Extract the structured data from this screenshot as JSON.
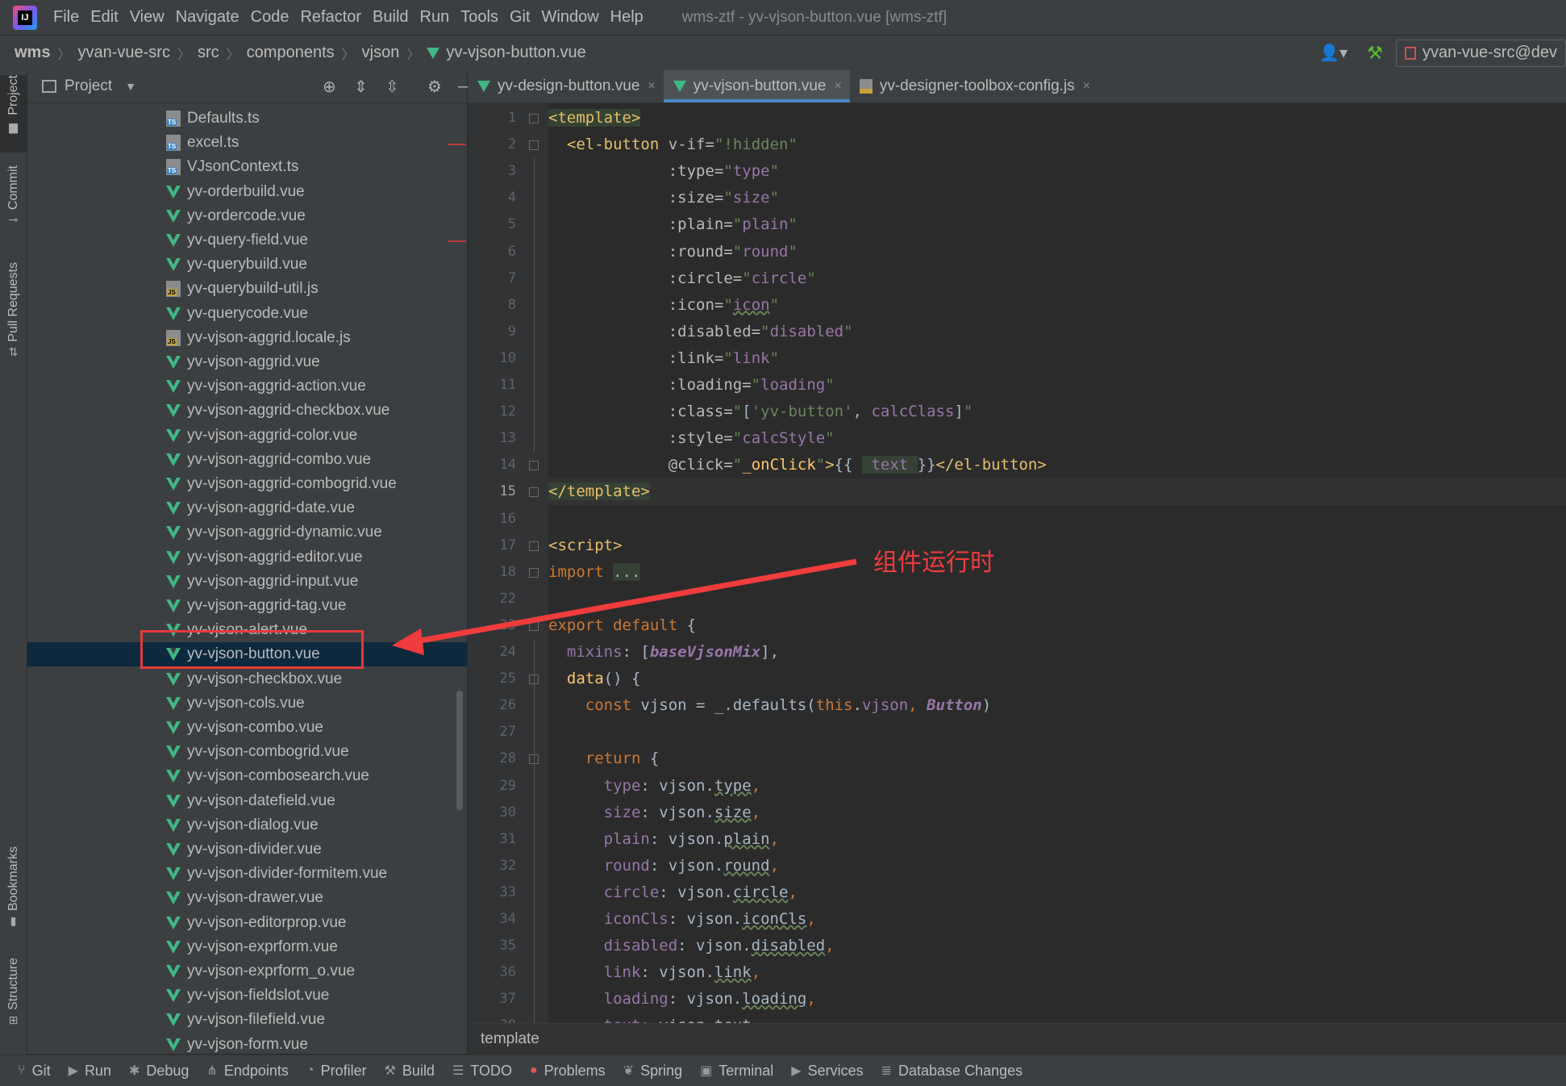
{
  "menubar": {
    "items": [
      "File",
      "Edit",
      "View",
      "Navigate",
      "Code",
      "Refactor",
      "Build",
      "Run",
      "Tools",
      "Git",
      "Window",
      "Help"
    ],
    "title": "wms-ztf - yv-vjson-button.vue [wms-ztf]"
  },
  "breadcrumb": {
    "items": [
      "wms",
      "yvan-vue-src",
      "src",
      "components",
      "vjson",
      "yv-vjson-button.vue"
    ],
    "branch": "yvan-vue-src@dev"
  },
  "left_stripe": {
    "project": "Project",
    "commit": "Commit",
    "pull_requests": "Pull Requests",
    "bookmarks": "Bookmarks",
    "structure": "Structure"
  },
  "project_panel": {
    "title": "Project"
  },
  "tree": [
    {
      "label": "Defaults.ts",
      "icon": "ts"
    },
    {
      "label": "excel.ts",
      "icon": "ts"
    },
    {
      "label": "VJsonContext.ts",
      "icon": "ts"
    },
    {
      "label": "yv-orderbuild.vue",
      "icon": "vue"
    },
    {
      "label": "yv-ordercode.vue",
      "icon": "vue"
    },
    {
      "label": "yv-query-field.vue",
      "icon": "vue"
    },
    {
      "label": "yv-querybuild.vue",
      "icon": "vue"
    },
    {
      "label": "yv-querybuild-util.js",
      "icon": "js"
    },
    {
      "label": "yv-querycode.vue",
      "icon": "vue"
    },
    {
      "label": "yv-vjson-aggrid.locale.js",
      "icon": "js"
    },
    {
      "label": "yv-vjson-aggrid.vue",
      "icon": "vue"
    },
    {
      "label": "yv-vjson-aggrid-action.vue",
      "icon": "vue"
    },
    {
      "label": "yv-vjson-aggrid-checkbox.vue",
      "icon": "vue"
    },
    {
      "label": "yv-vjson-aggrid-color.vue",
      "icon": "vue"
    },
    {
      "label": "yv-vjson-aggrid-combo.vue",
      "icon": "vue"
    },
    {
      "label": "yv-vjson-aggrid-combogrid.vue",
      "icon": "vue"
    },
    {
      "label": "yv-vjson-aggrid-date.vue",
      "icon": "vue"
    },
    {
      "label": "yv-vjson-aggrid-dynamic.vue",
      "icon": "vue"
    },
    {
      "label": "yv-vjson-aggrid-editor.vue",
      "icon": "vue"
    },
    {
      "label": "yv-vjson-aggrid-input.vue",
      "icon": "vue"
    },
    {
      "label": "yv-vjson-aggrid-tag.vue",
      "icon": "vue"
    },
    {
      "label": "yv-vjson-alert.vue",
      "icon": "vue"
    },
    {
      "label": "yv-vjson-button.vue",
      "icon": "vue",
      "selected": true
    },
    {
      "label": "yv-vjson-checkbox.vue",
      "icon": "vue"
    },
    {
      "label": "yv-vjson-cols.vue",
      "icon": "vue"
    },
    {
      "label": "yv-vjson-combo.vue",
      "icon": "vue"
    },
    {
      "label": "yv-vjson-combogrid.vue",
      "icon": "vue"
    },
    {
      "label": "yv-vjson-combosearch.vue",
      "icon": "vue"
    },
    {
      "label": "yv-vjson-datefield.vue",
      "icon": "vue"
    },
    {
      "label": "yv-vjson-dialog.vue",
      "icon": "vue"
    },
    {
      "label": "yv-vjson-divider.vue",
      "icon": "vue"
    },
    {
      "label": "yv-vjson-divider-formitem.vue",
      "icon": "vue"
    },
    {
      "label": "yv-vjson-drawer.vue",
      "icon": "vue"
    },
    {
      "label": "yv-vjson-editorprop.vue",
      "icon": "vue"
    },
    {
      "label": "yv-vjson-exprform.vue",
      "icon": "vue"
    },
    {
      "label": "yv-vjson-exprform_o.vue",
      "icon": "vue"
    },
    {
      "label": "yv-vjson-fieldslot.vue",
      "icon": "vue"
    },
    {
      "label": "yv-vjson-filefield.vue",
      "icon": "vue"
    },
    {
      "label": "yv-vjson-form.vue",
      "icon": "vue"
    }
  ],
  "editor_tabs": [
    {
      "label": "yv-design-button.vue",
      "icon": "vue",
      "active": false
    },
    {
      "label": "yv-vjson-button.vue",
      "icon": "vue",
      "active": true
    },
    {
      "label": "yv-designer-toolbox-config.js",
      "icon": "js",
      "active": false
    }
  ],
  "code": {
    "current_line": "15",
    "lines": [
      {
        "n": "1",
        "parts": [
          [
            "tag hl",
            "<template>"
          ]
        ]
      },
      {
        "n": "2",
        "parts": [
          [
            "plain",
            "  "
          ],
          [
            "tag",
            "<el-button "
          ],
          [
            "attr",
            "v-if="
          ],
          [
            "str",
            "\"!hidden\""
          ]
        ]
      },
      {
        "n": "3",
        "parts": [
          [
            "plain",
            "             "
          ],
          [
            "attr",
            ":type="
          ],
          [
            "str",
            "\""
          ],
          [
            "prop",
            "type"
          ],
          [
            "str",
            "\""
          ]
        ]
      },
      {
        "n": "4",
        "parts": [
          [
            "plain",
            "             "
          ],
          [
            "attr",
            ":size="
          ],
          [
            "str",
            "\""
          ],
          [
            "prop",
            "size"
          ],
          [
            "str",
            "\""
          ]
        ]
      },
      {
        "n": "5",
        "parts": [
          [
            "plain",
            "             "
          ],
          [
            "attr",
            ":plain="
          ],
          [
            "str",
            "\""
          ],
          [
            "prop",
            "plain"
          ],
          [
            "str",
            "\""
          ]
        ]
      },
      {
        "n": "6",
        "parts": [
          [
            "plain",
            "             "
          ],
          [
            "attr",
            ":round="
          ],
          [
            "str",
            "\""
          ],
          [
            "prop",
            "round"
          ],
          [
            "str",
            "\""
          ]
        ]
      },
      {
        "n": "7",
        "parts": [
          [
            "plain",
            "             "
          ],
          [
            "attr",
            ":circle="
          ],
          [
            "str",
            "\""
          ],
          [
            "prop",
            "circle"
          ],
          [
            "str",
            "\""
          ]
        ]
      },
      {
        "n": "8",
        "parts": [
          [
            "plain",
            "             "
          ],
          [
            "attr",
            ":icon="
          ],
          [
            "str",
            "\""
          ],
          [
            "prop sq",
            "icon"
          ],
          [
            "str",
            "\""
          ]
        ]
      },
      {
        "n": "9",
        "parts": [
          [
            "plain",
            "             "
          ],
          [
            "attr",
            ":disabled="
          ],
          [
            "str",
            "\""
          ],
          [
            "prop",
            "disabled"
          ],
          [
            "str",
            "\""
          ]
        ]
      },
      {
        "n": "10",
        "parts": [
          [
            "plain",
            "             "
          ],
          [
            "attr",
            ":link="
          ],
          [
            "str",
            "\""
          ],
          [
            "prop",
            "link"
          ],
          [
            "str",
            "\""
          ]
        ]
      },
      {
        "n": "11",
        "parts": [
          [
            "plain",
            "             "
          ],
          [
            "attr",
            ":loading="
          ],
          [
            "str",
            "\""
          ],
          [
            "prop",
            "loading"
          ],
          [
            "str",
            "\""
          ]
        ]
      },
      {
        "n": "12",
        "parts": [
          [
            "plain",
            "             "
          ],
          [
            "attr",
            ":class="
          ],
          [
            "str",
            "\""
          ],
          [
            "plain",
            "["
          ],
          [
            "str",
            "'yv-button'"
          ],
          [
            "plain",
            ", "
          ],
          [
            "prop",
            "calcClass"
          ],
          [
            "plain",
            "]"
          ],
          [
            "str",
            "\""
          ]
        ]
      },
      {
        "n": "13",
        "parts": [
          [
            "plain",
            "             "
          ],
          [
            "attr",
            ":style="
          ],
          [
            "str",
            "\""
          ],
          [
            "prop",
            "calcStyle"
          ],
          [
            "str",
            "\""
          ]
        ]
      },
      {
        "n": "14",
        "parts": [
          [
            "plain",
            "             "
          ],
          [
            "attr",
            "@click="
          ],
          [
            "str",
            "\""
          ],
          [
            "fn",
            "_onClick"
          ],
          [
            "str",
            "\""
          ],
          [
            "tag",
            ">"
          ],
          [
            "plain",
            "{{ "
          ],
          [
            "prop hl",
            " text "
          ],
          [
            "plain",
            "}}"
          ],
          [
            "tag",
            "</el-button>"
          ]
        ]
      },
      {
        "n": "15",
        "parts": [
          [
            "tag hl",
            "</template>"
          ]
        ]
      },
      {
        "n": "16",
        "parts": []
      },
      {
        "n": "17",
        "parts": [
          [
            "tag",
            "<script>"
          ]
        ]
      },
      {
        "n": "18",
        "parts": [
          [
            "kw",
            "import "
          ],
          [
            "plain hl",
            "..."
          ]
        ]
      },
      {
        "n": "22",
        "parts": []
      },
      {
        "n": "23",
        "parts": [
          [
            "kw",
            "export default "
          ],
          [
            "plain",
            "{"
          ]
        ]
      },
      {
        "n": "24",
        "parts": [
          [
            "plain",
            "  "
          ],
          [
            "prop",
            "mixins"
          ],
          [
            "plain",
            ": ["
          ],
          [
            "ital",
            "baseVjsonMix"
          ],
          [
            "plain",
            "],"
          ]
        ]
      },
      {
        "n": "25",
        "parts": [
          [
            "plain",
            "  "
          ],
          [
            "fn",
            "data"
          ],
          [
            "plain",
            "() {"
          ]
        ]
      },
      {
        "n": "26",
        "parts": [
          [
            "plain",
            "    "
          ],
          [
            "kw",
            "const "
          ],
          [
            "plain",
            "vjson = _."
          ],
          [
            "plain",
            "defaults("
          ],
          [
            "kw",
            "this"
          ],
          [
            "plain",
            "."
          ],
          [
            "prop",
            "vjson"
          ],
          [
            "kw",
            ", "
          ],
          [
            "ital",
            "Button"
          ],
          [
            "plain",
            ")"
          ]
        ]
      },
      {
        "n": "27",
        "parts": []
      },
      {
        "n": "28",
        "parts": [
          [
            "plain",
            "    "
          ],
          [
            "kw",
            "return "
          ],
          [
            "plain",
            "{"
          ]
        ]
      },
      {
        "n": "29",
        "parts": [
          [
            "plain",
            "      "
          ],
          [
            "prop",
            "type"
          ],
          [
            "plain",
            ": vjson."
          ],
          [
            "plain sq",
            "type"
          ],
          [
            "kw",
            ","
          ]
        ]
      },
      {
        "n": "30",
        "parts": [
          [
            "plain",
            "      "
          ],
          [
            "prop",
            "size"
          ],
          [
            "plain",
            ": vjson."
          ],
          [
            "plain sq",
            "size"
          ],
          [
            "kw",
            ","
          ]
        ]
      },
      {
        "n": "31",
        "parts": [
          [
            "plain",
            "      "
          ],
          [
            "prop",
            "plain"
          ],
          [
            "plain",
            ": vjson."
          ],
          [
            "plain sq",
            "plain"
          ],
          [
            "kw",
            ","
          ]
        ]
      },
      {
        "n": "32",
        "parts": [
          [
            "plain",
            "      "
          ],
          [
            "prop",
            "round"
          ],
          [
            "plain",
            ": vjson."
          ],
          [
            "plain sq",
            "round"
          ],
          [
            "kw",
            ","
          ]
        ]
      },
      {
        "n": "33",
        "parts": [
          [
            "plain",
            "      "
          ],
          [
            "prop",
            "circle"
          ],
          [
            "plain",
            ": vjson."
          ],
          [
            "plain sq",
            "circle"
          ],
          [
            "kw",
            ","
          ]
        ]
      },
      {
        "n": "34",
        "parts": [
          [
            "plain",
            "      "
          ],
          [
            "prop",
            "iconCls"
          ],
          [
            "plain",
            ": vjson."
          ],
          [
            "plain sq",
            "iconCls"
          ],
          [
            "kw",
            ","
          ]
        ]
      },
      {
        "n": "35",
        "parts": [
          [
            "plain",
            "      "
          ],
          [
            "prop",
            "disabled"
          ],
          [
            "plain",
            ": vjson."
          ],
          [
            "plain sq",
            "disabled"
          ],
          [
            "kw",
            ","
          ]
        ]
      },
      {
        "n": "36",
        "parts": [
          [
            "plain",
            "      "
          ],
          [
            "prop",
            "link"
          ],
          [
            "plain",
            ": vjson."
          ],
          [
            "plain sq",
            "link"
          ],
          [
            "kw",
            ","
          ]
        ]
      },
      {
        "n": "37",
        "parts": [
          [
            "plain",
            "      "
          ],
          [
            "prop",
            "loading"
          ],
          [
            "plain",
            ": vjson."
          ],
          [
            "plain sq",
            "loading"
          ],
          [
            "kw",
            ","
          ]
        ]
      },
      {
        "n": "38",
        "parts": [
          [
            "plain",
            "      "
          ],
          [
            "prop",
            "text"
          ],
          [
            "plain",
            ": vjson.text"
          ]
        ]
      }
    ]
  },
  "editor_breadcrumb": "template",
  "annotation": {
    "text": "组件运行时",
    "color": "#f03c3c"
  },
  "bottom_tools": [
    {
      "label": "Git",
      "icon": "git-icon"
    },
    {
      "label": "Run",
      "icon": "run-icon"
    },
    {
      "label": "Debug",
      "icon": "debug-icon"
    },
    {
      "label": "Endpoints",
      "icon": "endpoints-icon"
    },
    {
      "label": "Profiler",
      "icon": "profiler-icon"
    },
    {
      "label": "Build",
      "icon": "build-icon"
    },
    {
      "label": "TODO",
      "icon": "todo-icon"
    },
    {
      "label": "Problems",
      "icon": "problems-icon"
    },
    {
      "label": "Spring",
      "icon": "spring-icon"
    },
    {
      "label": "Terminal",
      "icon": "terminal-icon"
    },
    {
      "label": "Services",
      "icon": "services-icon"
    },
    {
      "label": "Database Changes",
      "icon": "database-changes-icon"
    }
  ]
}
